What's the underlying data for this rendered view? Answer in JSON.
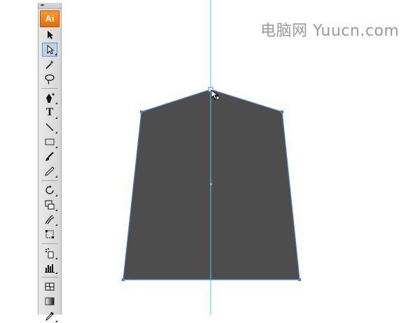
{
  "app": {
    "logo_text": "Ai"
  },
  "watermark": {
    "text": "电脑网 Yuucn.com"
  },
  "toolbar": {
    "tools": [
      {
        "name": "selection-tool",
        "icon": "arrow-icon"
      },
      {
        "name": "direct-selection-tool",
        "icon": "hollow-arrow-icon",
        "active": true
      },
      {
        "name": "magic-wand-tool",
        "icon": "magic-wand-icon"
      },
      {
        "name": "lasso-tool",
        "icon": "lasso-icon"
      },
      {
        "name": "pen-tool",
        "icon": "pen-add-icon"
      },
      {
        "name": "type-tool",
        "icon": "type-icon",
        "glyph": "T"
      },
      {
        "name": "line-segment-tool",
        "icon": "line-icon"
      },
      {
        "name": "rectangle-tool",
        "icon": "rectangle-icon"
      },
      {
        "name": "paintbrush-tool",
        "icon": "brush-icon"
      },
      {
        "name": "pencil-tool",
        "icon": "pencil-icon"
      },
      {
        "name": "rotate-tool",
        "icon": "rotate-icon"
      },
      {
        "name": "scale-tool",
        "icon": "scale-icon"
      },
      {
        "name": "warp-tool",
        "icon": "warp-icon"
      },
      {
        "name": "free-transform-tool",
        "icon": "free-transform-icon"
      },
      {
        "name": "symbol-sprayer-tool",
        "icon": "symbol-sprayer-icon"
      },
      {
        "name": "column-graph-tool",
        "icon": "column-graph-icon"
      },
      {
        "name": "mesh-tool",
        "icon": "mesh-icon"
      },
      {
        "name": "gradient-tool",
        "icon": "gradient-icon"
      },
      {
        "name": "eyedropper-tool",
        "icon": "eyedropper-icon"
      }
    ]
  },
  "artwork": {
    "fill_color": "#4d4d4d",
    "path_color": "#4f7fd6",
    "guide_color": "#3fd6e0"
  }
}
